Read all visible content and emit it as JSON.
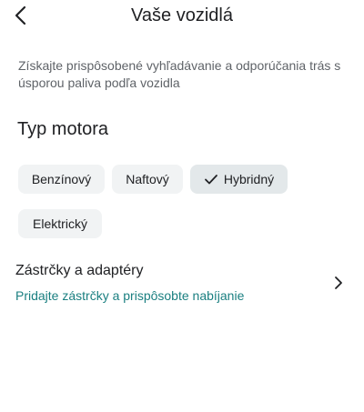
{
  "header": {
    "title": "Vaše vozidlá",
    "back_icon": "chevron-left-icon"
  },
  "subtitle": "Získajte prispôsobené vyhľadávanie a odporúčania trás s úsporou paliva podľa vozidla",
  "engine": {
    "title": "Typ motora",
    "options": [
      {
        "label": "Benzínový",
        "selected": false
      },
      {
        "label": "Naftový",
        "selected": false
      },
      {
        "label": "Hybridný",
        "selected": true
      },
      {
        "label": "Elektrický",
        "selected": false
      }
    ],
    "selected_icon": "check-icon"
  },
  "plugs": {
    "title": "Zástrčky a adaptéry",
    "subtitle": "Pridajte zástrčky a prispôsobte nabíjanie",
    "chevron_icon": "chevron-right-icon",
    "link_color": "#1a7f80"
  }
}
